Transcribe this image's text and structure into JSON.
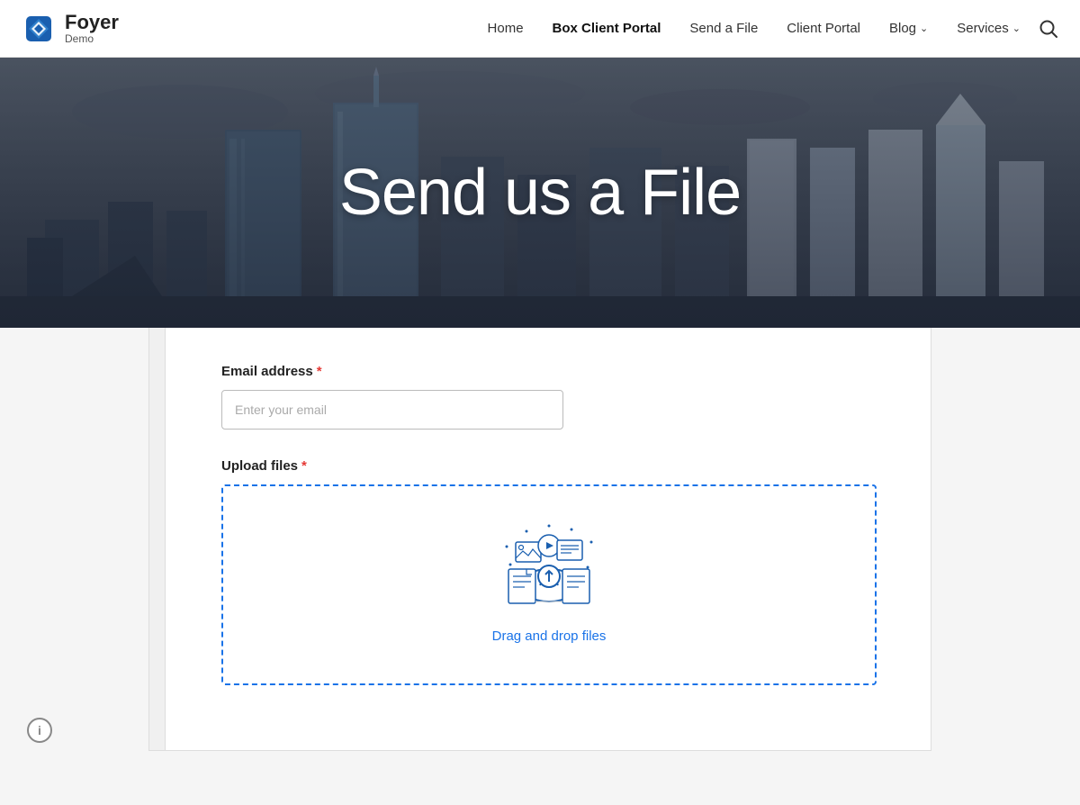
{
  "brand": {
    "name": "Foyer",
    "subtitle": "Demo"
  },
  "nav": {
    "links": [
      {
        "id": "home",
        "label": "Home",
        "active": false,
        "hasDropdown": false
      },
      {
        "id": "box-client-portal",
        "label": "Box Client Portal",
        "active": true,
        "hasDropdown": false
      },
      {
        "id": "send-a-file",
        "label": "Send a File",
        "active": false,
        "hasDropdown": false
      },
      {
        "id": "client-portal",
        "label": "Client Portal",
        "active": false,
        "hasDropdown": false
      },
      {
        "id": "blog",
        "label": "Blog",
        "active": false,
        "hasDropdown": true
      },
      {
        "id": "services",
        "label": "Services",
        "active": false,
        "hasDropdown": true
      }
    ]
  },
  "hero": {
    "title": "Send us a File"
  },
  "form": {
    "email_label": "Email address",
    "email_placeholder": "Enter your email",
    "upload_label": "Upload files",
    "drag_drop_text": "Drag and drop files",
    "required_marker": "*"
  },
  "icons": {
    "search": "🔍",
    "info": "ⓘ",
    "chevron": "∨"
  }
}
